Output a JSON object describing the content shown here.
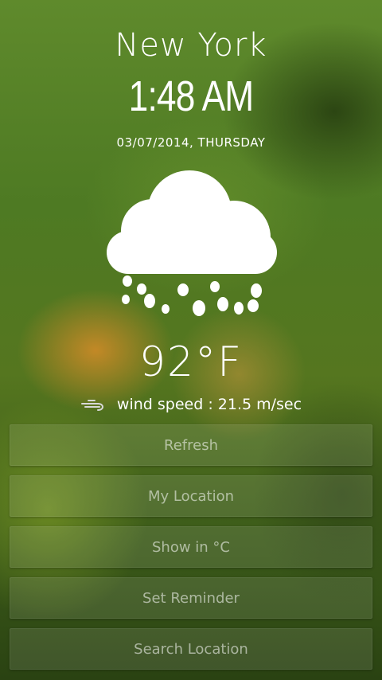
{
  "location": {
    "city": "New York"
  },
  "clock": {
    "time": "1:48 AM",
    "date": "03/07/2014, THURSDAY"
  },
  "weather": {
    "condition_icon": "cloud-rain-icon",
    "temperature": "92°F"
  },
  "wind": {
    "icon": "wind-icon",
    "text": "wind speed : 21.5 m/sec"
  },
  "actions": [
    {
      "label": "Refresh"
    },
    {
      "label": "My Location"
    },
    {
      "label": "Show in °C"
    },
    {
      "label": "Set Reminder"
    },
    {
      "label": "Search Location"
    }
  ]
}
